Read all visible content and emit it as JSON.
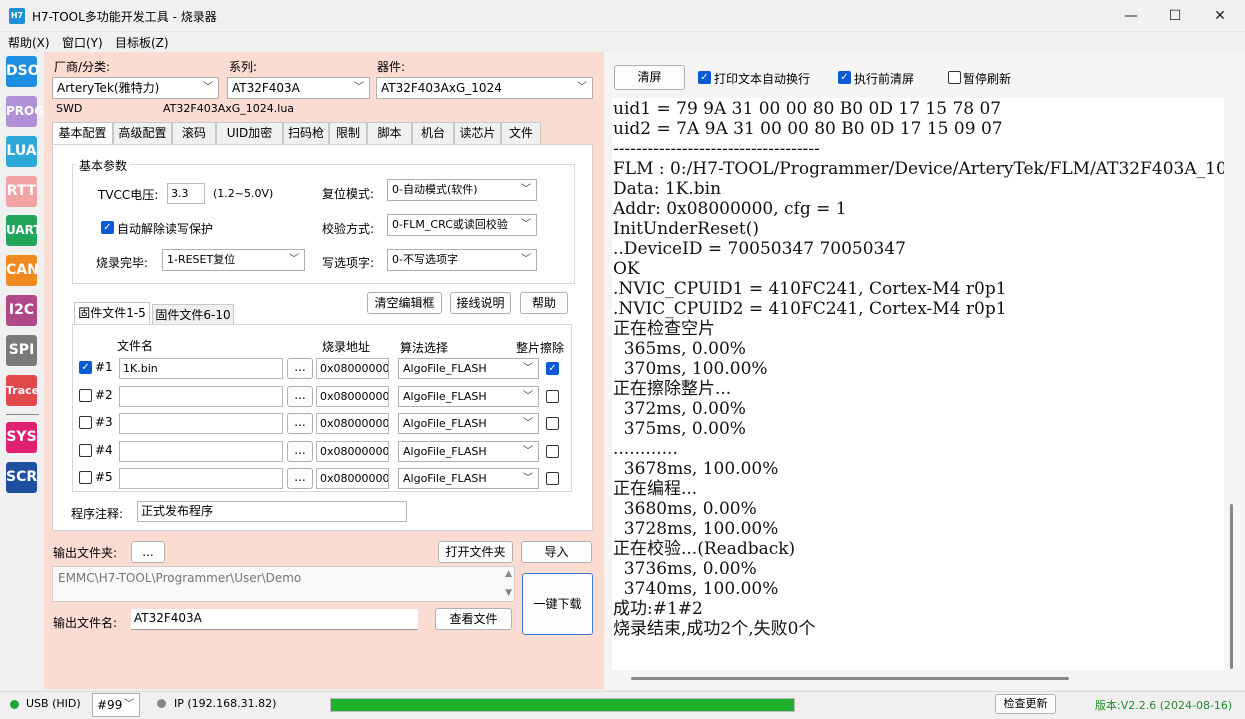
{
  "window": {
    "icon_text": "H7",
    "title": "H7-TOOL多功能开发工具 - 烧录器",
    "minimize": "—",
    "maximize": "☐",
    "close": "✕"
  },
  "menu": [
    "帮助(X)",
    "窗口(Y)",
    "目标板(Z)"
  ],
  "nav": [
    {
      "label": "DSO",
      "color": "#1e8fe0"
    },
    {
      "label": "PROG",
      "color": "#b290d8"
    },
    {
      "label": "LUA",
      "color": "#2ea8d8"
    },
    {
      "label": "RTT",
      "color": "#f2a4a4"
    },
    {
      "label": "UART",
      "color": "#22a55a"
    },
    {
      "label": "CAN",
      "color": "#f08a20"
    },
    {
      "label": "I2C",
      "color": "#b0488a"
    },
    {
      "label": "SPI",
      "color": "#7a7a7a"
    },
    {
      "label": "Trace",
      "color": "#e0484c"
    },
    {
      "label": "SYS",
      "color": "#e02070"
    },
    {
      "label": "SCR",
      "color": "#1e4fa0"
    }
  ],
  "selectors": {
    "vendor_label": "厂商/分类:",
    "vendor_value": "ArteryTek(雅特力)",
    "series_label": "系列:",
    "series_value": "AT32F403A",
    "device_label": "器件:",
    "device_value": "AT32F403AxG_1024",
    "interface": "SWD",
    "lua_file": "AT32F403AxG_1024.lua"
  },
  "tabs": [
    "基本配置",
    "高级配置",
    "滚码",
    "UID加密",
    "扫码枪",
    "限制",
    "脚本",
    "机台",
    "读芯片",
    "文件"
  ],
  "basic": {
    "group_title": "基本参数",
    "tvcc_label": "TVCC电压:",
    "tvcc_value": "3.3",
    "tvcc_range": "(1.2~5.0V)",
    "reset_label": "复位模式:",
    "reset_value": "0-自动模式(软件)",
    "auto_unlock_label": "自动解除读写保护",
    "auto_unlock_checked": true,
    "verify_label": "校验方式:",
    "verify_value": "0-FLM_CRC或读回校验",
    "after_label": "烧录完毕:",
    "after_value": "1-RESET复位",
    "option_label": "写选项字:",
    "option_value": "0-不写选项字"
  },
  "buttons": {
    "clear_edit": "清空编辑框",
    "wiring": "接线说明",
    "help": "帮助",
    "output_folder_browse": "...",
    "open_folder": "打开文件夹",
    "import": "导入",
    "view_file": "查看文件",
    "one_click": "一键下载",
    "file_browse": "..."
  },
  "file_tabs": [
    "固件文件1-5",
    "固件文件6-10"
  ],
  "file_table": {
    "headers": {
      "name": "文件名",
      "addr": "烧录地址",
      "algo": "算法选择",
      "erase": "整片擦除"
    },
    "rows": [
      {
        "idx": "#1",
        "checked": true,
        "name": "1K.bin",
        "addr": "0x08000000",
        "algo": "AlgoFile_FLASH",
        "erase": true
      },
      {
        "idx": "#2",
        "checked": false,
        "name": "",
        "addr": "0x08000000",
        "algo": "AlgoFile_FLASH",
        "erase": false
      },
      {
        "idx": "#3",
        "checked": false,
        "name": "",
        "addr": "0x08000000",
        "algo": "AlgoFile_FLASH",
        "erase": false
      },
      {
        "idx": "#4",
        "checked": false,
        "name": "",
        "addr": "0x08000000",
        "algo": "AlgoFile_FLASH",
        "erase": false
      },
      {
        "idx": "#5",
        "checked": false,
        "name": "",
        "addr": "0x08000000",
        "algo": "AlgoFile_FLASH",
        "erase": false
      }
    ]
  },
  "program_note": {
    "label": "程序注释:",
    "value": "正式发布程序"
  },
  "output": {
    "folder_label": "输出文件夹:",
    "folder_path": "EMMC\\H7-TOOL\\Programmer\\User\\Demo",
    "file_label": "输出文件名:",
    "file_value": "AT32F403A"
  },
  "right_toolbar": {
    "clear": "清屏",
    "auto_wrap": "打印文本自动换行",
    "auto_wrap_checked": true,
    "clear_before": "执行前清屏",
    "clear_before_checked": true,
    "pause": "暂停刷新",
    "pause_checked": false
  },
  "log_lines": [
    "uid1 = 79 9A 31 00 00 80 B0 0D 17 15 78 07",
    "uid2 = 7A 9A 31 00 00 80 B0 0D 17 15 09 07",
    "------------------------------------",
    "FLM : 0:/H7-TOOL/Programmer/Device/ArteryTek/FLM/AT32F403A_10",
    "Data: 1K.bin",
    "Addr: 0x08000000, cfg = 1",
    "InitUnderReset()",
    "..DeviceID = 70050347 70050347",
    "OK",
    ".NVIC_CPUID1 = 410FC241, Cortex-M4 r0p1",
    ".NVIC_CPUID2 = 410FC241, Cortex-M4 r0p1",
    "正在检查空片",
    "  365ms, 0.00%",
    "  370ms, 100.00%",
    "正在擦除整片...",
    "  372ms, 0.00%",
    "  375ms, 0.00%",
    "............",
    "  3678ms, 100.00%",
    "正在编程...",
    "  3680ms, 0.00%",
    "  3728ms, 100.00%",
    "正在校验...(Readback)",
    "  3736ms, 0.00%",
    "  3740ms, 100.00%",
    "成功:#1#2",
    "烧录结束,成功2个,失败0个"
  ],
  "status": {
    "usb": "USB (HID)",
    "usb_color": "#1fa33a",
    "channel": "#99",
    "ip": "IP (192.168.31.82)",
    "ip_color": "#888888",
    "progress": 1.0,
    "progress_color": "#1fb02c",
    "check_update": "检查更新",
    "version": "版本:V2.2.6 (2024-08-16)",
    "version_color": "#2a8a2a"
  }
}
